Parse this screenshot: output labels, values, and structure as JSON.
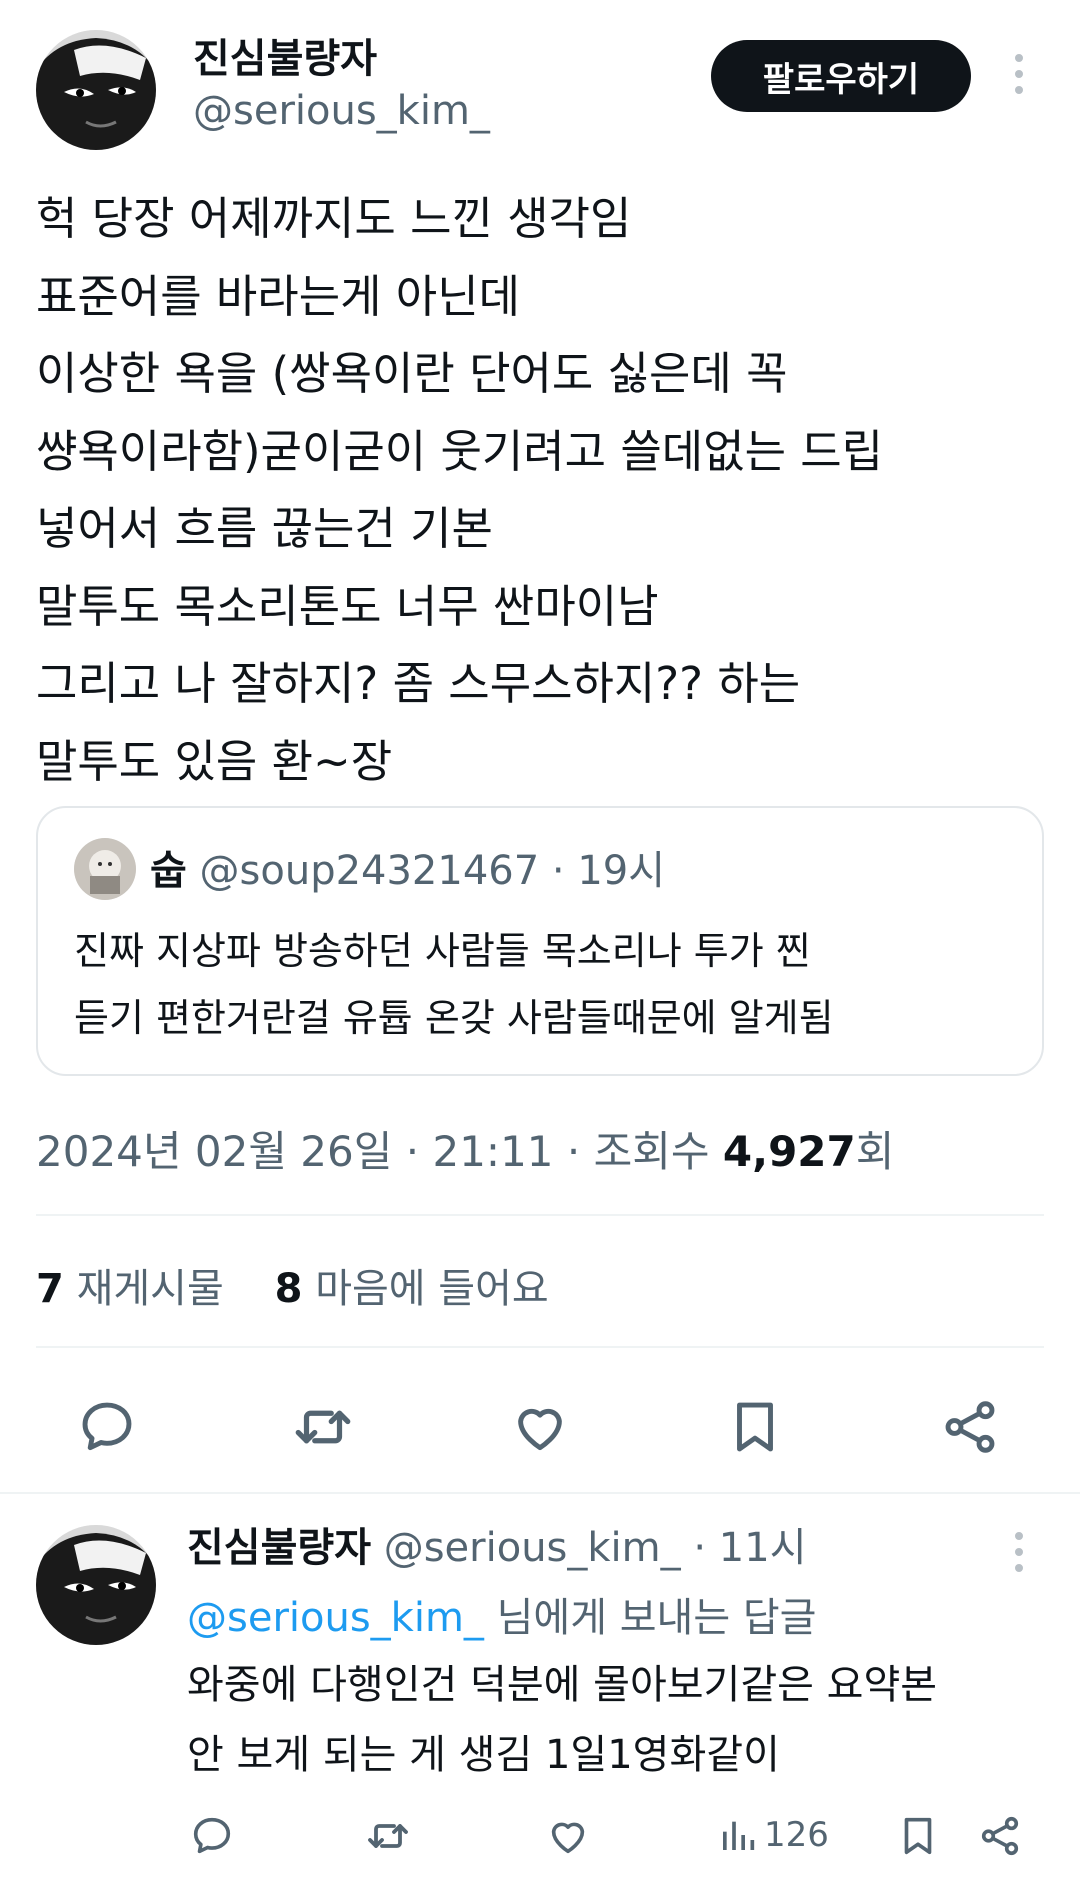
{
  "tweet": {
    "author_name": "진심불량자",
    "author_handle": "@serious_kim_",
    "follow_label": "팔로우하기",
    "body_lines": [
      "헉 당장 어제까지도 느낀 생각임",
      "표준어를 바라는게 아닌데",
      "이상한 욕을 (쌍욕이란 단어도 싫은데 꼭",
      "썅욕이라함)굳이굳이 웃기려고 쓸데없는 드립",
      "넣어서 흐름 끊는건 기본",
      "말투도 목소리톤도 너무 싼마이남",
      "그리고 나 잘하지? 좀 스무스하지?? 하는",
      "말투도 있음 환~장"
    ],
    "quote": {
      "name": "숩",
      "handle": "@soup24321467",
      "time": "19시",
      "body_lines": [
        "진짜 지상파 방송하던 사람들 목소리나 투가 찐",
        "듣기 편한거란걸 유튭 온갖 사람들때문에 알게됨"
      ]
    },
    "date": "2024년 02월 26일",
    "time": "21:11",
    "views_label": "조회수",
    "views_count": "4,927",
    "views_suffix": "회",
    "separator": "·",
    "reposts_count": "7",
    "reposts_label": "재게시물",
    "likes_count": "8",
    "likes_label": "마음에 들어요",
    "action_icons": [
      "reply-icon",
      "repost-icon",
      "like-icon",
      "bookmark-icon",
      "share-icon"
    ]
  },
  "reply": {
    "author_name": "진심불량자",
    "author_handle": "@serious_kim_",
    "time": "11시",
    "replying_to_mention": "@serious_kim_",
    "replying_to_suffix": " 님에게 보내는 답글",
    "body_lines": [
      "와중에 다행인건 덕분에 몰아보기같은 요약본",
      "안 보게 되는 게 생김 1일1영화같이"
    ],
    "views_count": "126",
    "action_icons": [
      "reply-icon",
      "repost-icon",
      "like-icon",
      "views-icon",
      "bookmark-icon",
      "share-icon"
    ]
  },
  "colors": {
    "text": "#0f1419",
    "secondary": "#536471",
    "link": "#1d9bf0",
    "border": "#eff3f4",
    "button_bg": "#0f1419"
  }
}
